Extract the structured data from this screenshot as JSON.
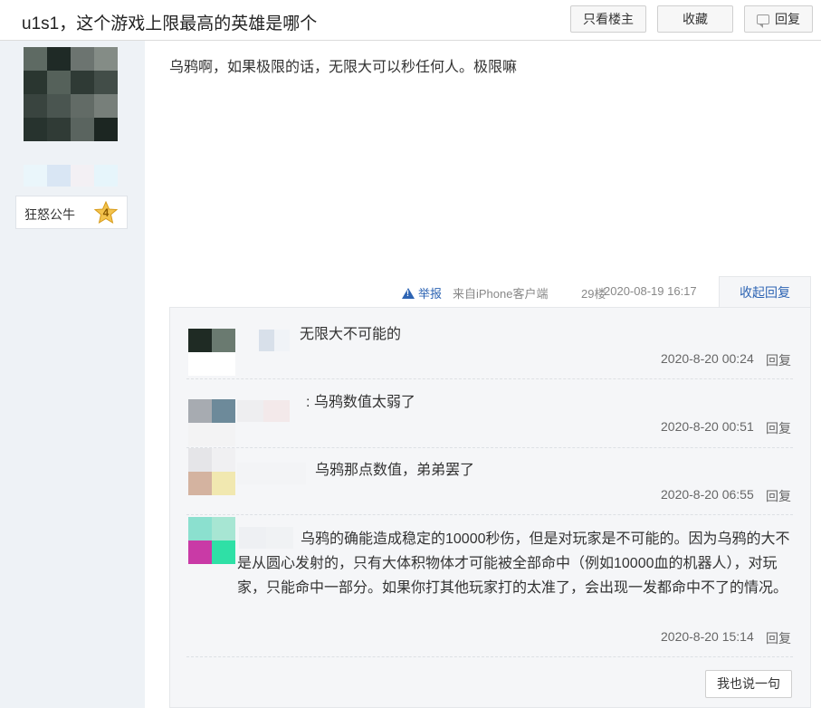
{
  "header": {
    "title": "u1s1，这个游戏上限最高的英雄是哪个",
    "only_op_label": "只看楼主",
    "favorite_label": "收藏",
    "reply_label": "回复"
  },
  "author": {
    "name": "狂怒公牛",
    "level": "4",
    "avatar_colors": [
      "#5e6a63",
      "#1f2a26",
      "#6c7470",
      "#848c86",
      "#2a3630",
      "#55615a",
      "#2f3a35",
      "#424d48",
      "#39443f",
      "#4a5550",
      "#626b66",
      "#777f7a",
      "#27332e",
      "#303b36",
      "#5a645f",
      "#1c2622"
    ],
    "badge_colors": [
      "#eaf6fb",
      "#d9e6f4",
      "#f3f0f4",
      "#e6f5fb"
    ]
  },
  "post": {
    "text": "乌鸦啊，如果极限的话，无限大可以秒任何人。极限嘛",
    "report_label": "举报",
    "source": "来自iPhone客户端",
    "floor": "29楼",
    "time": "2020-08-19 16:17",
    "collapse_label": "收起回复"
  },
  "comments": [
    {
      "text": "无限大不可能的",
      "time": "2020-8-20 00:24",
      "reply_label": "回复",
      "avatar_colors": [
        "#1f2b24",
        "#6a7a70",
        "#ffffff",
        "#ffffff"
      ],
      "name_colors": [
        "#d8e0ea",
        "#f0f3f7"
      ]
    },
    {
      "text": ": 乌鸦数值太弱了",
      "time": "2020-8-20 00:51",
      "reply_label": "回复",
      "avatar_colors": [
        "#a7abb1",
        "#6d8a9a",
        "#f3f3f4",
        "#f3f3f4"
      ],
      "name_colors": [
        "#eeeef0",
        "#f3e9ea"
      ]
    },
    {
      "text": "乌鸦那点数值，弟弟罢了",
      "time": "2020-8-20 06:55",
      "reply_label": "回复",
      "avatar_colors": [
        "#e5e5e8",
        "#f0f0f2",
        "#d4b3a0",
        "#f1e8b0"
      ],
      "name_colors": [
        "#f3f4f6",
        "#f3f4f6"
      ]
    },
    {
      "text": "乌鸦的确能造成稳定的10000秒伤，但是对玩家是不可能的。因为乌鸦的大不是从圆心发射的，只有大体积物体才可能被全部命中（例如10000血的机器人），对玩家，只能命中一部分。如果你打其他玩家打的太准了，会出现一发都命中不了的情况。",
      "time": "2020-8-20 15:14",
      "reply_label": "回复",
      "avatar_colors": [
        "#8be0cf",
        "#a7e6d3",
        "#c93aa6",
        "#2fe0a6"
      ],
      "name_colors": [
        "#eef0f3",
        "#f0f2f4"
      ]
    }
  ],
  "say_label": "我也说一句"
}
